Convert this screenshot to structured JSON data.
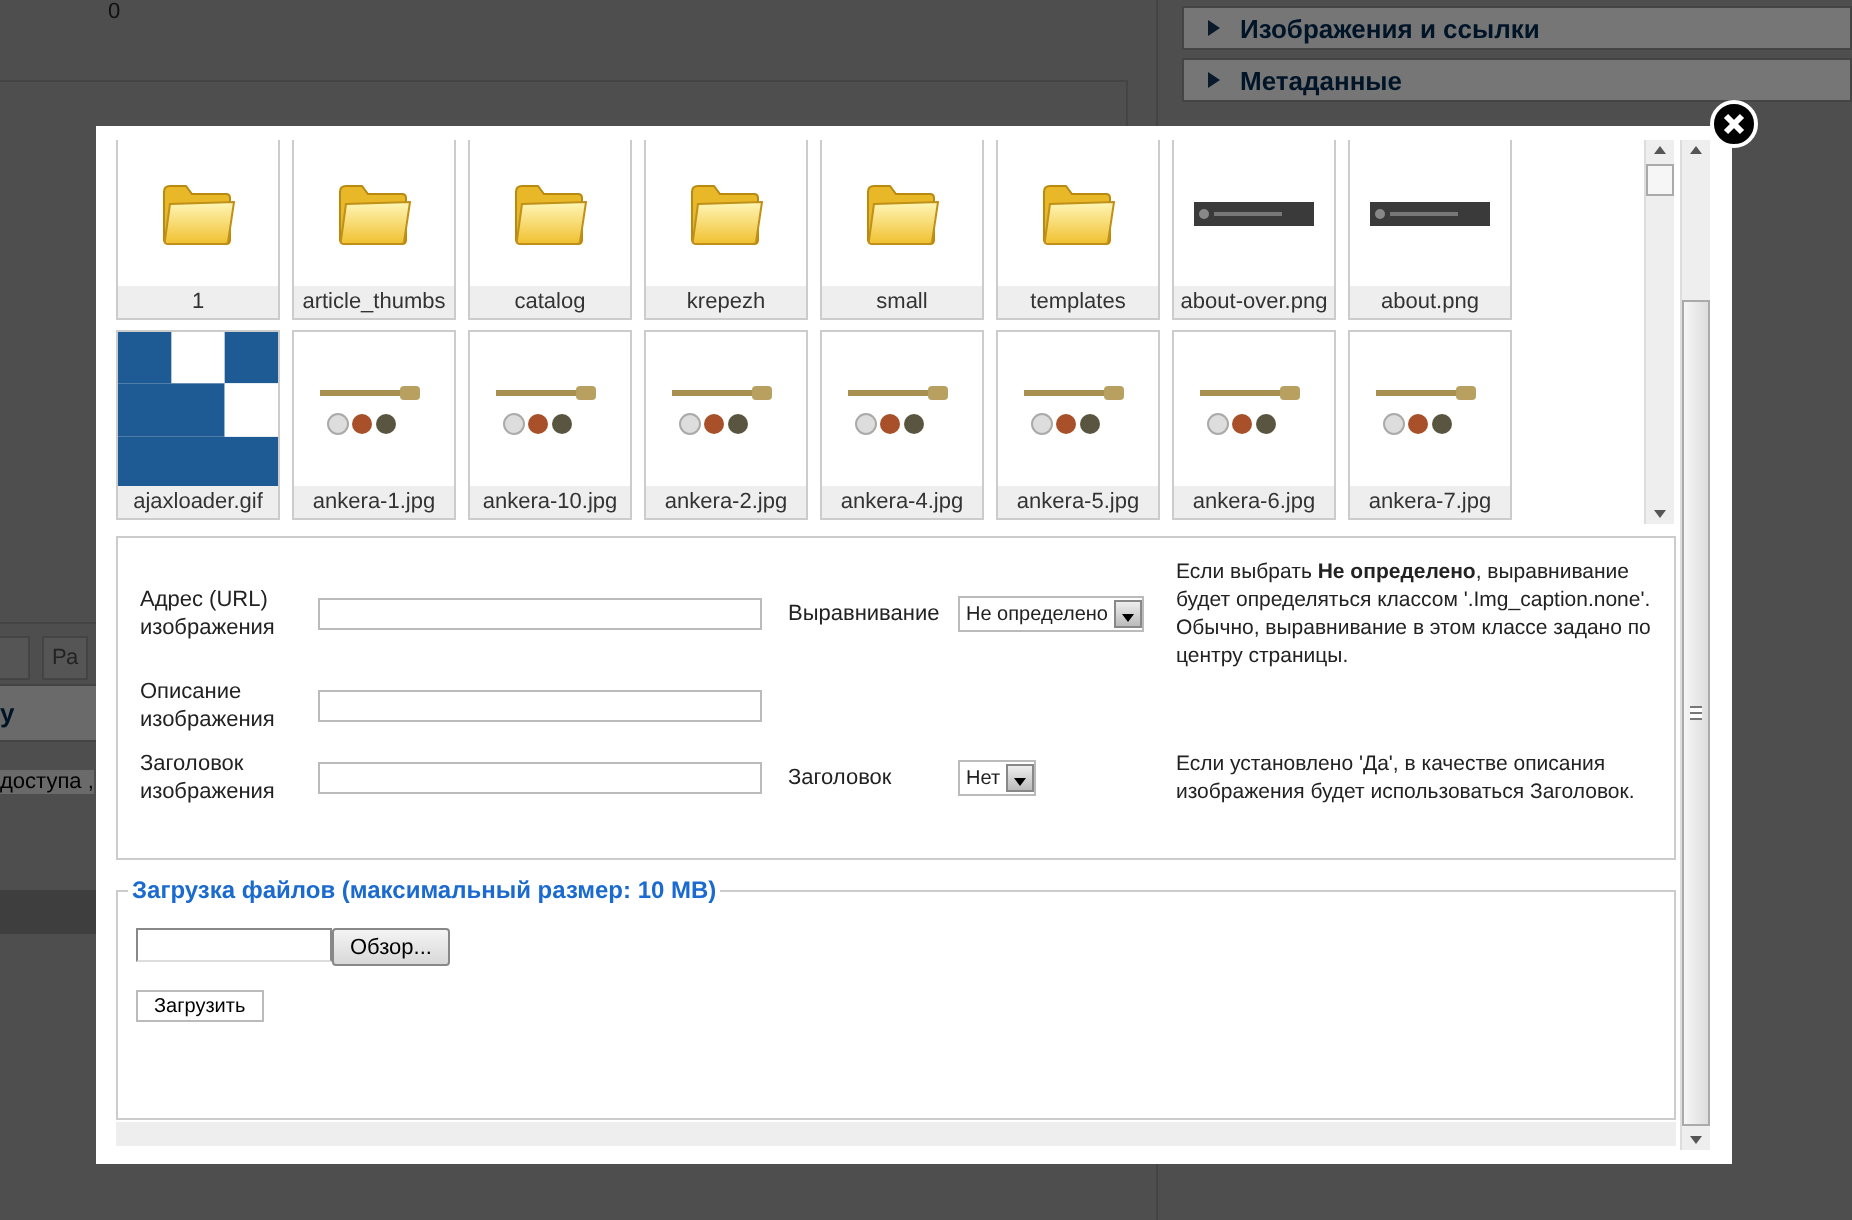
{
  "background": {
    "counter": "0",
    "panels": [
      "Изображения и ссылки",
      "Метаданные"
    ],
    "heading_fragment": "y",
    "text_fragment": "доступа ,",
    "button_fragment": "Ра"
  },
  "thumbnails": [
    {
      "label": "1",
      "kind": "folder"
    },
    {
      "label": "article_thumbs",
      "kind": "folder"
    },
    {
      "label": "catalog",
      "kind": "folder"
    },
    {
      "label": "krepezh",
      "kind": "folder"
    },
    {
      "label": "small",
      "kind": "folder"
    },
    {
      "label": "templates",
      "kind": "folder"
    },
    {
      "label": "about-over.png",
      "kind": "picture"
    },
    {
      "label": "about.png",
      "kind": "picture"
    },
    {
      "label": "ajaxloader.gif",
      "kind": "picture"
    },
    {
      "label": "ankera-1.jpg",
      "kind": "picture"
    },
    {
      "label": "ankera-10.jpg",
      "kind": "picture"
    },
    {
      "label": "ankera-2.jpg",
      "kind": "picture"
    },
    {
      "label": "ankera-4.jpg",
      "kind": "picture"
    },
    {
      "label": "ankera-5.jpg",
      "kind": "picture"
    },
    {
      "label": "ankera-6.jpg",
      "kind": "picture"
    },
    {
      "label": "ankera-7.jpg",
      "kind": "picture"
    }
  ],
  "form": {
    "url_label": "Адрес (URL) изображения",
    "align_label": "Выравнивание",
    "align_value": "Не определено",
    "align_help": "Если выбрать **Не определено**, выравнивание будет определяться классом '.Img_caption.none'. Обычно, выравнивание в этом классе задано по центру страницы.",
    "desc_label": "Описание изображения",
    "title_label": "Заголовок изображения",
    "caption_label": "Заголовок",
    "caption_value": "Нет",
    "caption_help": "Если установлено 'Да', в качестве описания изображения будет использоваться Заголовок."
  },
  "upload": {
    "legend": "Загрузка файлов (максимальный размер: 10 MB)",
    "browse_button": "Обзор...",
    "upload_button": "Загрузить"
  }
}
